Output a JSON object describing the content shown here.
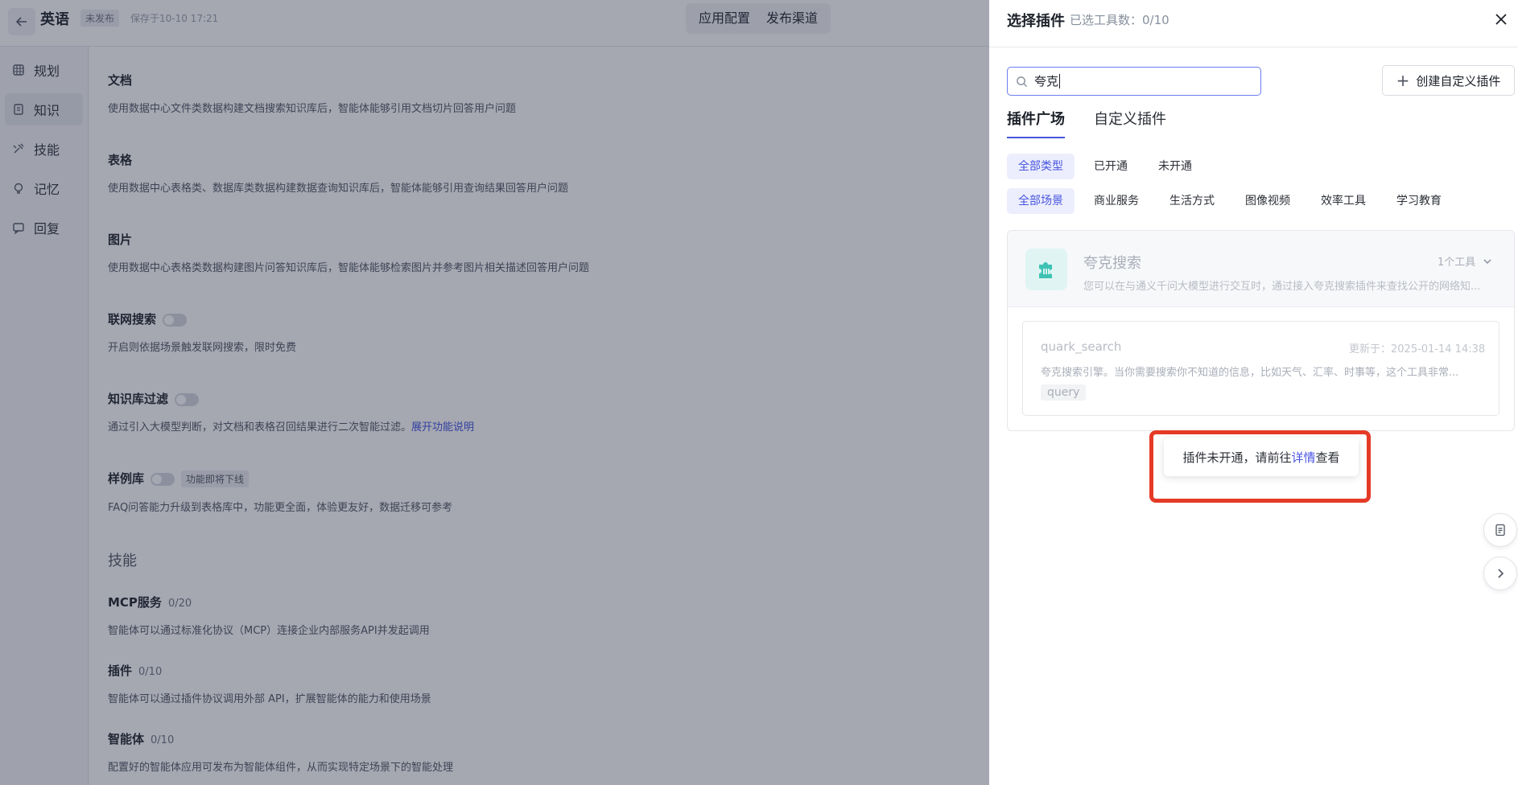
{
  "header": {
    "app_title": "英语",
    "status": "未发布",
    "saved_at": "保存于10-10 17:21",
    "tabs": [
      "应用配置",
      "发布渠道"
    ]
  },
  "sidebar": {
    "items": [
      {
        "label": "规划",
        "icon": "grid-icon"
      },
      {
        "label": "知识",
        "icon": "book-icon"
      },
      {
        "label": "技能",
        "icon": "tools-icon"
      },
      {
        "label": "记忆",
        "icon": "lightbulb-icon"
      },
      {
        "label": "回复",
        "icon": "reply-icon"
      }
    ],
    "active_index": 1
  },
  "content": {
    "doc": {
      "title": "文档",
      "desc": "使用数据中心文件类数据构建文档搜索知识库后，智能体能够引用文档切片回答用户问题"
    },
    "table": {
      "title": "表格",
      "desc": "使用数据中心表格类、数据库类数据构建数据查询知识库后，智能体能够引用查询结果回答用户问题"
    },
    "image": {
      "title": "图片",
      "desc": "使用数据中心表格类数据构建图片问答知识库后，智能体能够检索图片并参考图片相关描述回答用户问题"
    },
    "web_search": {
      "title": "联网搜索",
      "desc": "开启则依据场景触发联网搜索，限时免费",
      "enabled": false
    },
    "kb_filter": {
      "title": "知识库过滤",
      "desc": "通过引入大模型判断，对文档和表格召回结果进行二次智能过滤。",
      "link": "展开功能说明",
      "enabled": false
    },
    "example_lib": {
      "title": "样例库",
      "badge": "功能即将下线",
      "desc": "FAQ问答能力升级到表格库中，功能更全面，体验更友好，数据迁移可参考",
      "enabled": false
    },
    "skills_heading": "技能",
    "mcp": {
      "title": "MCP服务",
      "count": "0/20",
      "desc": "智能体可以通过标准化协议（MCP）连接企业内部服务API并发起调用"
    },
    "plugin": {
      "title": "插件",
      "count": "0/10",
      "desc": "智能体可以通过插件协议调用外部 API，扩展智能体的能力和使用场景"
    },
    "agent": {
      "title": "智能体",
      "count": "0/10",
      "desc": "配置好的智能体应用可发布为智能体组件，从而实现特定场景下的智能处理"
    }
  },
  "drawer": {
    "title": "选择插件",
    "selected_count": "已选工具数：0/10",
    "search": {
      "value": "夸克",
      "placeholder": ""
    },
    "create_button": "创建自定义插件",
    "tabs": [
      {
        "label": "插件广场",
        "active": true
      },
      {
        "label": "自定义插件",
        "active": false
      }
    ],
    "type_filters": [
      {
        "label": "全部类型",
        "active": true
      },
      {
        "label": "已开通",
        "active": false
      },
      {
        "label": "未开通",
        "active": false
      }
    ],
    "scene_filters": [
      {
        "label": "全部场景",
        "active": true
      },
      {
        "label": "商业服务",
        "active": false
      },
      {
        "label": "生活方式",
        "active": false
      },
      {
        "label": "图像视频",
        "active": false
      },
      {
        "label": "效率工具",
        "active": false
      },
      {
        "label": "学习教育",
        "active": false
      }
    ],
    "plugin": {
      "name": "夸克搜索",
      "desc": "您可以在与通义千问大模型进行交互时，通过接入夸克搜索插件来查找公开的网络知...",
      "tool_count": "1个工具",
      "tool": {
        "name": "quark_search",
        "updated": "更新于：2025-01-14 14:38",
        "desc": "夸克搜索引擎。当你需要搜索你不知道的信息，比如天气、汇率、时事等，这个工具非常...",
        "param": "query"
      }
    },
    "tooltip": {
      "prefix": "插件未开通，请前往",
      "link": "详情",
      "suffix": "查看"
    }
  },
  "colors": {
    "accent": "#4855e0",
    "highlight": "#e53a26",
    "overlay": "rgba(40,45,70,0.42)"
  }
}
